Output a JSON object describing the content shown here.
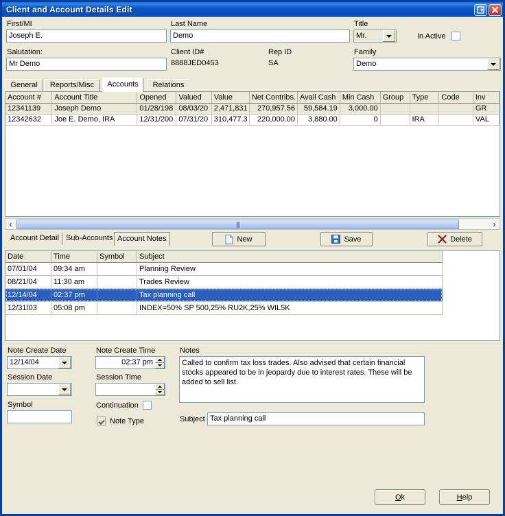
{
  "window": {
    "title": "Client and Account Details Edit",
    "restore_icon": "restore-icon",
    "close_icon": "close-icon"
  },
  "header": {
    "first_mi_label": "First/MI",
    "first_mi_value": "Joseph E.",
    "last_name_label": "Last Name",
    "last_name_value": "Demo",
    "title_label": "Title",
    "title_value": "Mr.",
    "inactive_label": "In Active",
    "inactive_checked": false,
    "salutation_label": "Salutation:",
    "salutation_value": "Mr Demo",
    "client_id_label": "Client ID#",
    "client_id_value": "8888JED0453",
    "rep_id_label": "Rep ID",
    "rep_id_value": "SA",
    "family_label": "Family",
    "family_value": "Demo"
  },
  "tabs": [
    {
      "label": "General",
      "selected": false
    },
    {
      "label": "Reports/Misc",
      "selected": false
    },
    {
      "label": "Accounts",
      "selected": true
    },
    {
      "label": "Relations",
      "selected": false
    }
  ],
  "accounts_grid": {
    "columns": [
      "Account #",
      "Account Title",
      "Opened",
      "Valued",
      "Value",
      "Net Contribs.",
      "Avail Cash",
      "Min Cash",
      "Group",
      "Type",
      "Code",
      "Inv"
    ],
    "rows": [
      {
        "selected": true,
        "cells": [
          "12341139",
          "Joseph Demo",
          "01/28/198",
          "08/03/20",
          "2,471,831",
          "270,957.56",
          "59,584.19",
          "3,000.00",
          "",
          "",
          "",
          "GR"
        ]
      },
      {
        "selected": false,
        "cells": [
          "12342632",
          "Joe E. Demo, IRA",
          "12/31/200",
          "07/31/20",
          "310,477.3",
          "220,000.00",
          "3,880.00",
          "0",
          "",
          "IRA",
          "",
          "VAL"
        ]
      }
    ]
  },
  "scrollbar": {
    "left_icon": "chevron-left-icon",
    "right_icon": "chevron-right-icon",
    "grip": "||||"
  },
  "subtabs": [
    {
      "label": "Account Detail",
      "selected": false
    },
    {
      "label": "Sub-Accounts",
      "selected": false
    },
    {
      "label": "Account Notes",
      "selected": true
    }
  ],
  "actions": {
    "new_label": "New",
    "new_icon": "page-icon",
    "save_label": "Save",
    "save_icon": "floppy-disk-icon",
    "delete_label": "Delete",
    "delete_icon": "x-icon"
  },
  "notes_grid": {
    "columns": [
      "Date",
      "Time",
      "Symbol",
      "Subject"
    ],
    "rows": [
      {
        "selected": false,
        "cells": [
          "07/01/04",
          "09:34 am",
          "",
          "Planning Review"
        ]
      },
      {
        "selected": false,
        "cells": [
          "08/21/04",
          "11:30 am",
          "",
          "Trades Review"
        ]
      },
      {
        "selected": true,
        "cells": [
          "12/14/04",
          "02:37 pm",
          "",
          "Tax planning call"
        ]
      },
      {
        "selected": false,
        "cells": [
          "12/31/03",
          "05:08 pm",
          "",
          "INDEX=50% SP 500,25% RU2K,25% WIL5K"
        ]
      }
    ]
  },
  "detail": {
    "note_create_date_label": "Note Create Date",
    "note_create_date_value": "12/14/04",
    "note_create_time_label": "Note Create Time",
    "note_create_time_value": "02:37 pm",
    "session_date_label": "Session Date",
    "session_date_value": "",
    "session_time_label": "Session Time",
    "session_time_value": "",
    "symbol_label": "Symbol",
    "symbol_value": "",
    "continuation_label": "Continuation",
    "continuation_checked": false,
    "note_type_label": "Note Type",
    "note_type_checked": true,
    "notes_label": "Notes",
    "notes_value": "Called to confirm tax loss trades.  Also advised that certain financial stocks appeared to be in jeopardy due to interest rates.  These will be added to sell list.",
    "subject_label": "Subject",
    "subject_value": "Tax planning call"
  },
  "footer": {
    "ok_pre": "",
    "ok_mnemonic": "O",
    "ok_post": "k",
    "help_pre": "",
    "help_mnemonic": "H",
    "help_post": "elp"
  },
  "colors": {
    "title_bar": "#0b4cbb",
    "face": "#ece9d8",
    "selection": "#2a5fbf",
    "field_border": "#7f9db9"
  }
}
